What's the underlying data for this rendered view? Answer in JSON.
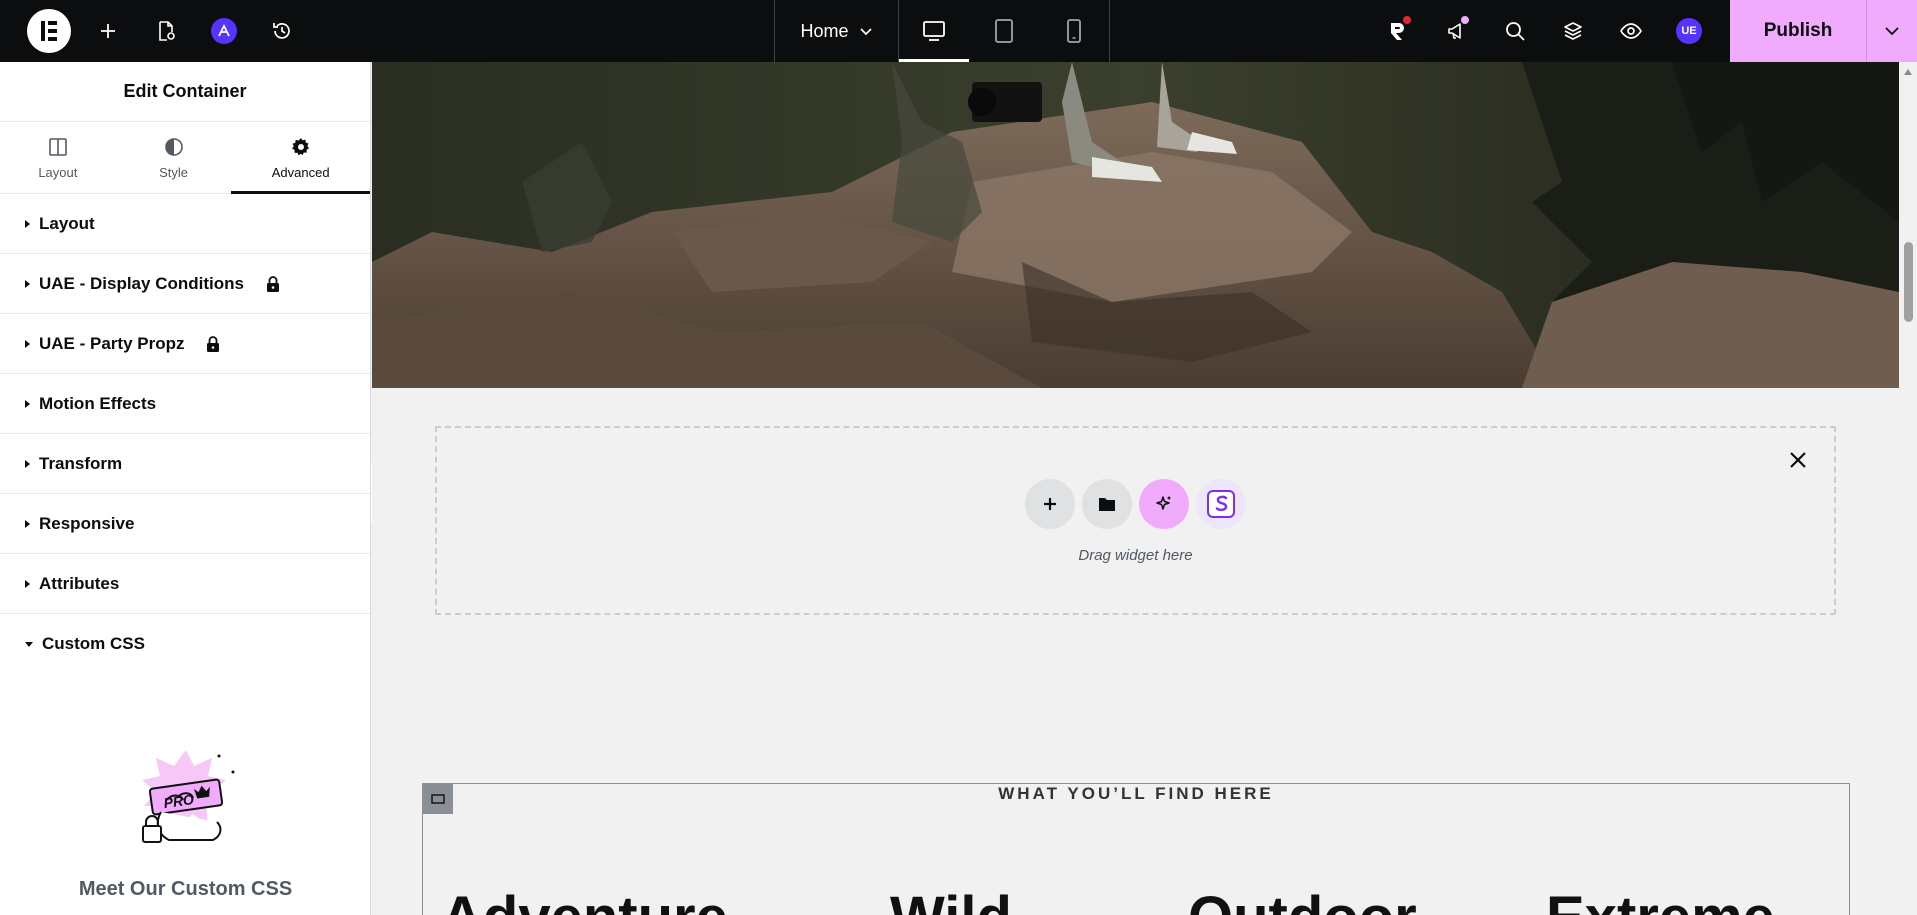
{
  "topbar": {
    "page_name": "Home",
    "publish_label": "Publish",
    "user_initials": "UE",
    "devices": [
      "desktop",
      "tablet",
      "mobile"
    ]
  },
  "sidebar": {
    "title": "Edit Container",
    "tabs": [
      {
        "label": "Layout",
        "icon": "layout-icon"
      },
      {
        "label": "Style",
        "icon": "contrast-icon"
      },
      {
        "label": "Advanced",
        "icon": "gear-icon"
      }
    ],
    "active_tab": "Advanced",
    "sections": [
      {
        "label": "Layout",
        "locked": false
      },
      {
        "label": "UAE - Display Conditions",
        "locked": true
      },
      {
        "label": "UAE - Party Propz",
        "locked": true
      },
      {
        "label": "Motion Effects",
        "locked": false
      },
      {
        "label": "Transform",
        "locked": false
      },
      {
        "label": "Responsive",
        "locked": false
      },
      {
        "label": "Attributes",
        "locked": false
      },
      {
        "label": "Custom CSS",
        "locked": false,
        "open": true
      }
    ],
    "promo": {
      "badge_text": "PRO",
      "title": "Meet Our Custom CSS"
    }
  },
  "canvas": {
    "dropzone_text": "Drag widget here",
    "eyebrow": "WHAT YOU’LL FIND HERE",
    "big_words": [
      "Adventure",
      "Wild",
      "Outdoor",
      "Extreme"
    ]
  },
  "colors": {
    "topbar_bg": "#0c0d0e",
    "publish_bg": "#f0abfc",
    "accent_purple": "#5733ff",
    "canvas_bg": "#f1f1f1"
  }
}
